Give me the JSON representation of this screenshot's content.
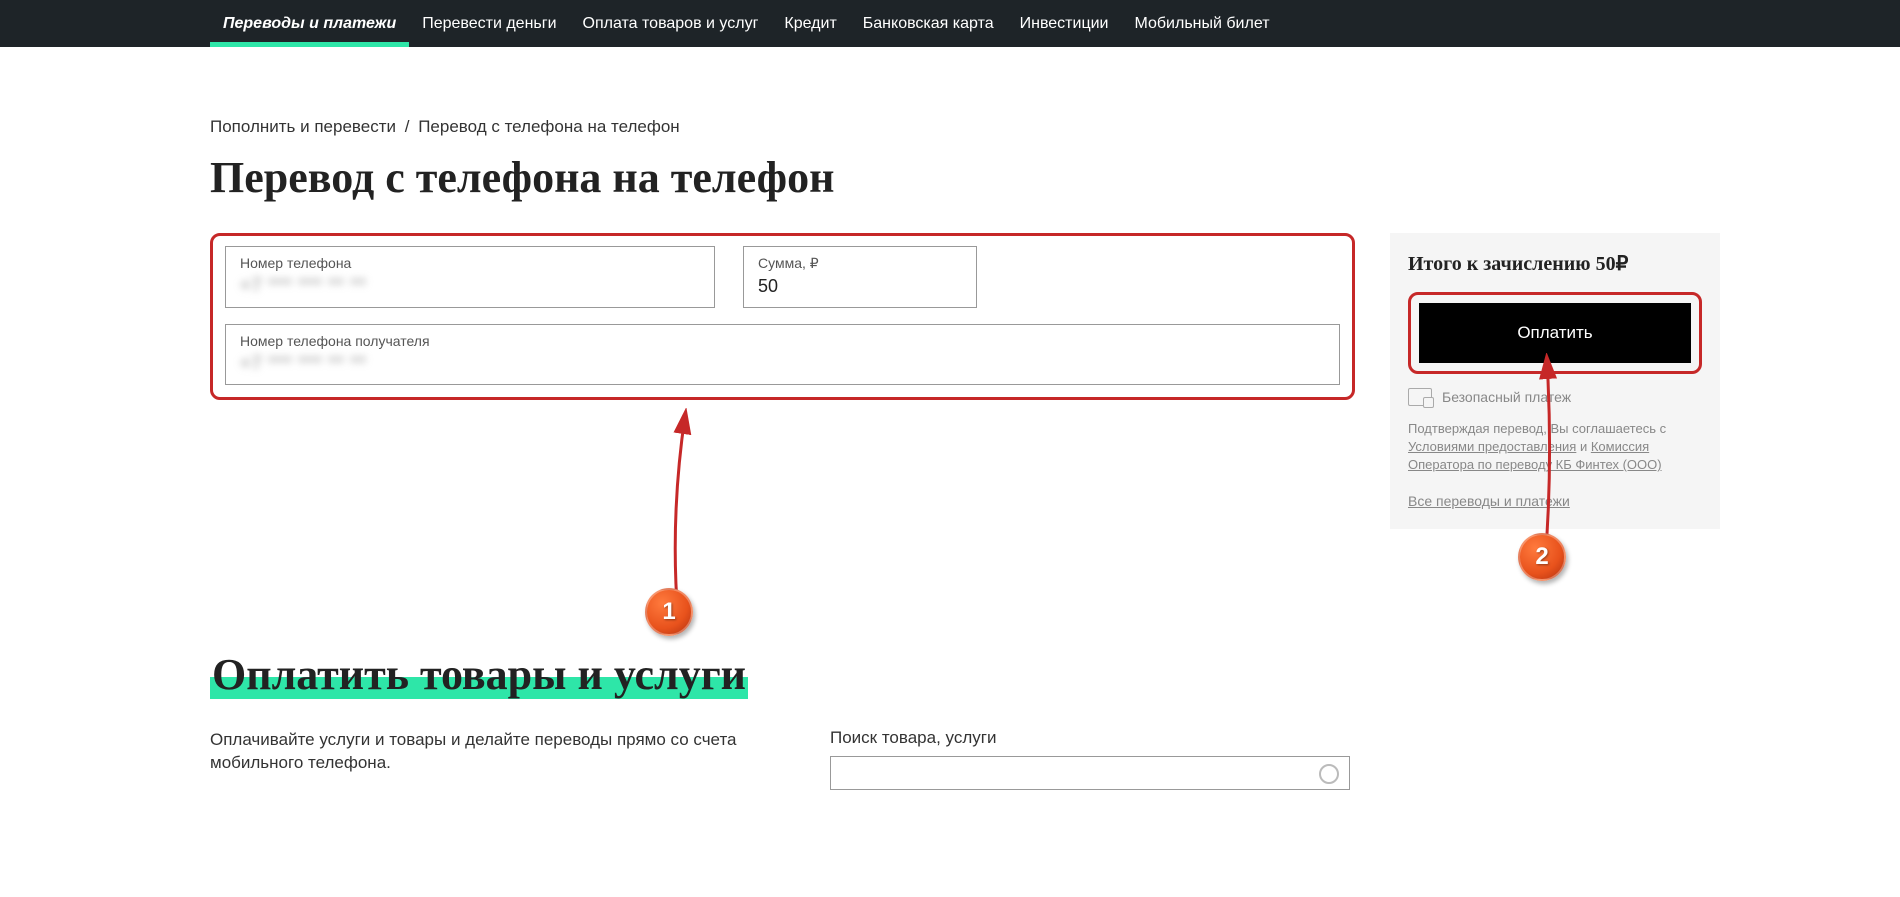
{
  "nav": {
    "items": [
      {
        "label": "Переводы и платежи",
        "active": true
      },
      {
        "label": "Перевести деньги",
        "active": false
      },
      {
        "label": "Оплата товаров и услуг",
        "active": false
      },
      {
        "label": "Кредит",
        "active": false
      },
      {
        "label": "Банковская карта",
        "active": false
      },
      {
        "label": "Инвестиции",
        "active": false
      },
      {
        "label": "Мобильный билет",
        "active": false
      }
    ]
  },
  "breadcrumb": {
    "parent": "Пополнить и перевести",
    "sep": "/",
    "current": "Перевод с телефона на телефон"
  },
  "page_title": "Перевод с телефона на телефон",
  "form": {
    "phone_from_label": "Номер телефона",
    "phone_from_value": "+7 *** *** ** **",
    "amount_label": "Сумма, ₽",
    "amount_value": "50",
    "phone_to_label": "Номер телефона получателя",
    "phone_to_value": "+7 *** *** ** **"
  },
  "sidebar": {
    "total_label": "Итого к зачислению 50₽",
    "pay_label": "Оплатить",
    "secure_label": "Безопасный платеж",
    "terms_prefix": "Подтверждая перевод, Вы соглашаетесь с ",
    "terms_link1": "Условиями предоставления",
    "terms_mid": " и ",
    "terms_link2": "Комиссия Оператора по переводу КБ Финтех (ООО)",
    "all_link": "Все переводы и платежи"
  },
  "annotations": {
    "badge1": "1",
    "badge2": "2"
  },
  "section2": {
    "title": "Оплатить товары и услуги",
    "desc": "Оплачивайте услуги и товары и делайте переводы прямо со счета мобильного телефона.",
    "search_label": "Поиск товара, услуги"
  }
}
